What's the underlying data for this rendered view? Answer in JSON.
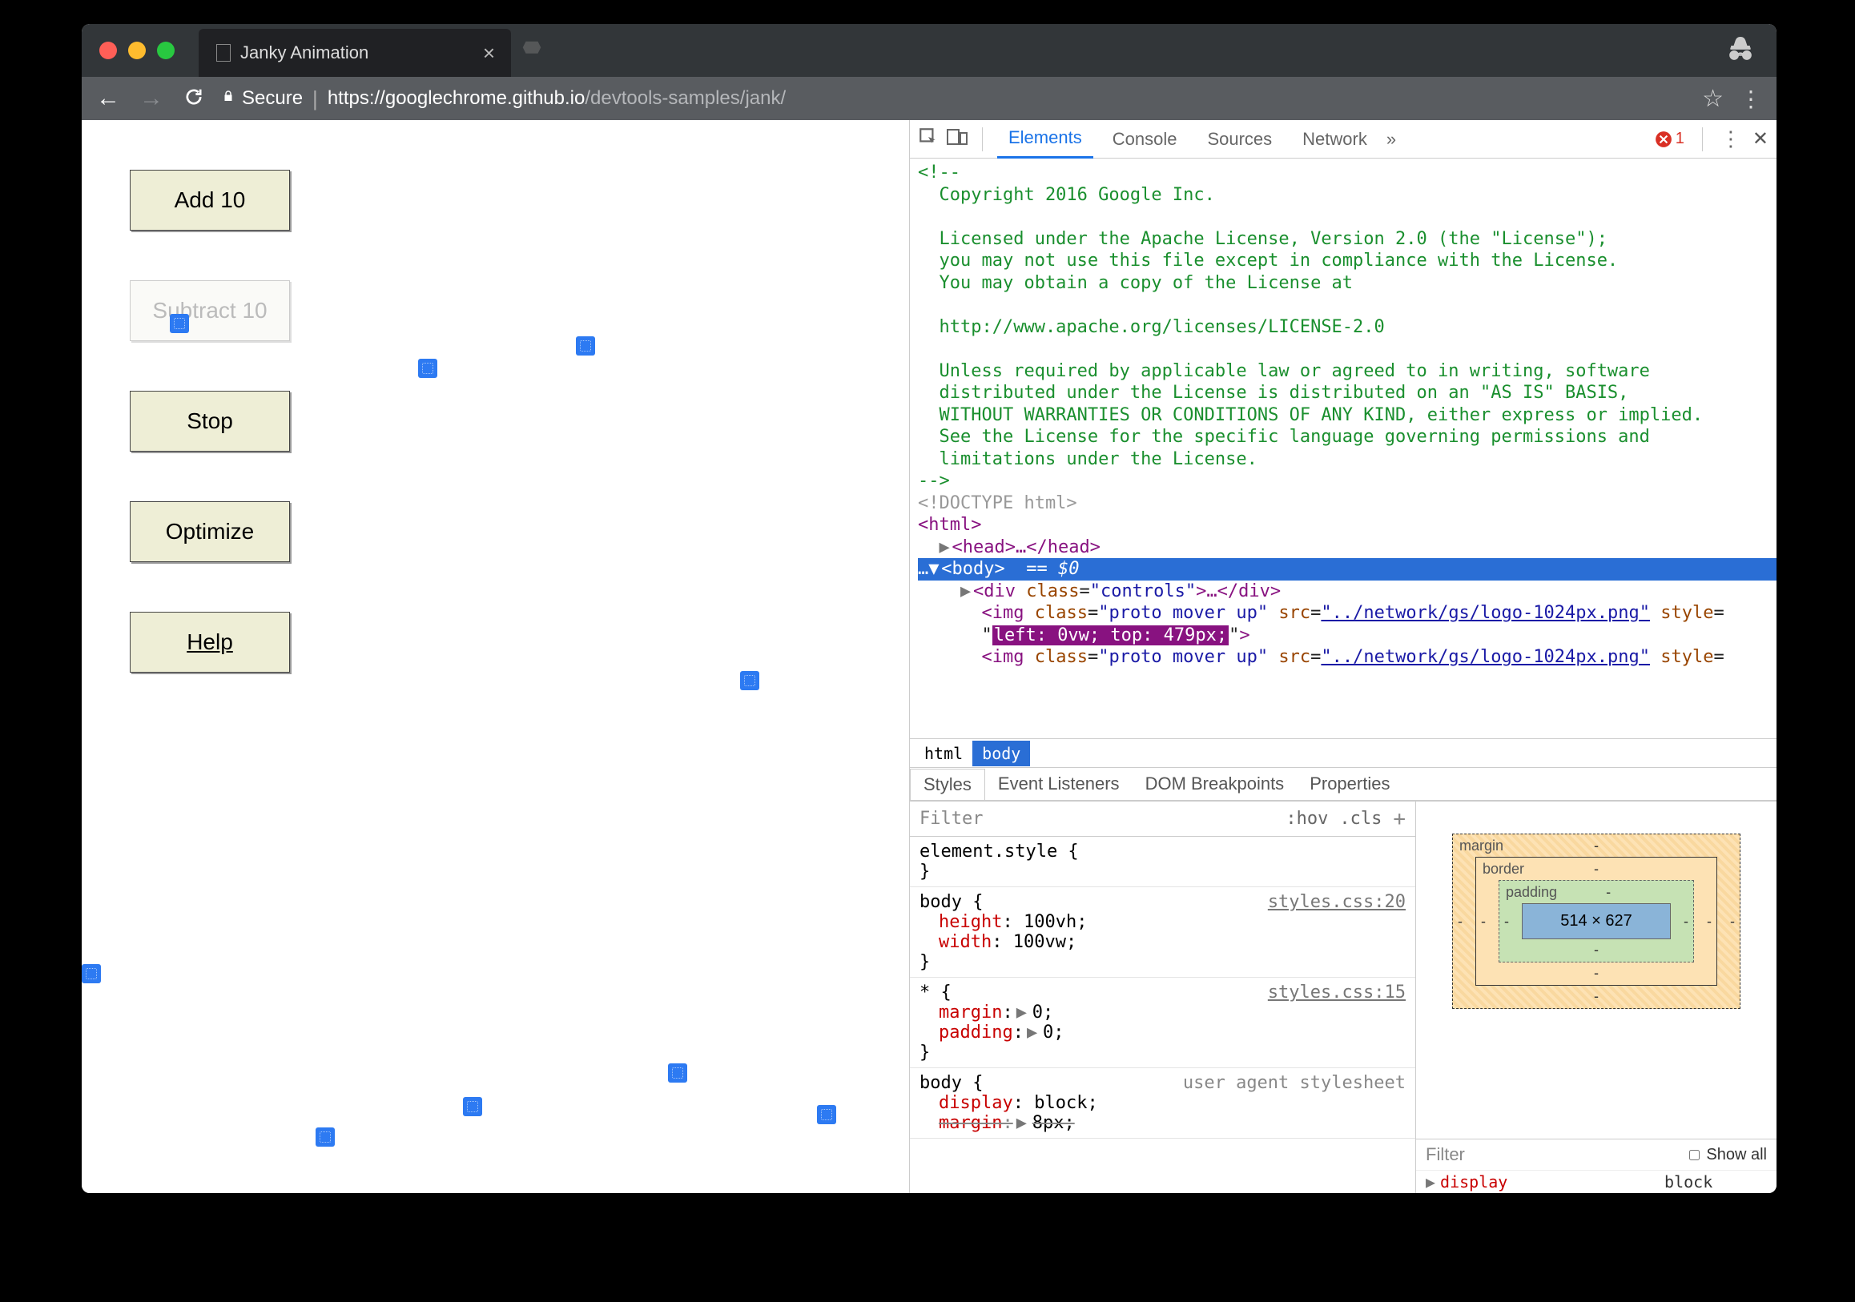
{
  "browser": {
    "tab_title": "Janky Animation",
    "secure_label": "Secure",
    "url_primary": "https://googlechrome.github.io",
    "url_secondary": "/devtools-samples/jank/"
  },
  "page": {
    "btn_add": "Add 10",
    "btn_subtract": "Subtract 10",
    "btn_stop": "Stop",
    "btn_optimize": "Optimize",
    "btn_help": "Help"
  },
  "devtools": {
    "tabs": {
      "elements": "Elements",
      "console": "Console",
      "sources": "Sources",
      "network": "Network"
    },
    "more": "»",
    "error_count": "1",
    "comment_text": "<!--\n  Copyright 2016 Google Inc.\n\n  Licensed under the Apache License, Version 2.0 (the \"License\");\n  you may not use this file except in compliance with the License.\n  You may obtain a copy of the License at\n\n  http://www.apache.org/licenses/LICENSE-2.0\n\n  Unless required by applicable law or agreed to in writing, software\n  distributed under the License is distributed on an \"AS IS\" BASIS,\n  WITHOUT WARRANTIES OR CONDITIONS OF ANY KIND, either express or implied.\n  See the License for the specific language governing permissions and\n  limitations under the License.\n-->",
    "doctype": "<!DOCTYPE html>",
    "html_open": "<html>",
    "head_line": "<head>…</head>",
    "body_open": "<body>",
    "body_suffix": "== $0",
    "controls_open": "<div",
    "controls_class_attr": "class",
    "controls_class_val": "\"controls\"",
    "controls_close": ">…</div>",
    "img_open": "<img",
    "img_class_attr": "class",
    "img_class_val": "\"proto mover up\"",
    "img_src_attr": "src",
    "img_src_val": "\"../network/gs/logo-1024px.png\"",
    "img_style_attr": "style",
    "img_style_eq": "=",
    "img_style_val_hl": "left: 0vw; top: 479px;",
    "img_close": ">",
    "crumb_html": "html",
    "crumb_body": "body"
  },
  "styles": {
    "tabs": {
      "styles": "Styles",
      "listeners": "Event Listeners",
      "dom": "DOM Breakpoints",
      "props": "Properties"
    },
    "filter_placeholder": "Filter",
    "hov": ":hov",
    "cls": ".cls",
    "rule0": "element.style {",
    "rule0_close": "}",
    "rule1_sel": "body {",
    "rule1_src": "styles.css:20",
    "rule1_p1": "height",
    "rule1_v1": "100vh;",
    "rule1_p2": "width",
    "rule1_v2": "100vw;",
    "rule2_sel": "* {",
    "rule2_src": "styles.css:15",
    "rule2_p1": "margin",
    "rule2_v1": "0;",
    "rule2_p2": "padding",
    "rule2_v2": "0;",
    "rule3_sel": "body {",
    "rule3_src": "user agent stylesheet",
    "rule3_p1": "display",
    "rule3_v1": "block;",
    "rule3_p2": "margin",
    "rule3_v2": "8px;"
  },
  "boxmodel": {
    "margin": "margin",
    "border": "border",
    "padding": "padding",
    "dims": "514 × 627"
  },
  "computed": {
    "filter": "Filter",
    "show_all": "Show all",
    "p1": "display",
    "v1": "block"
  }
}
